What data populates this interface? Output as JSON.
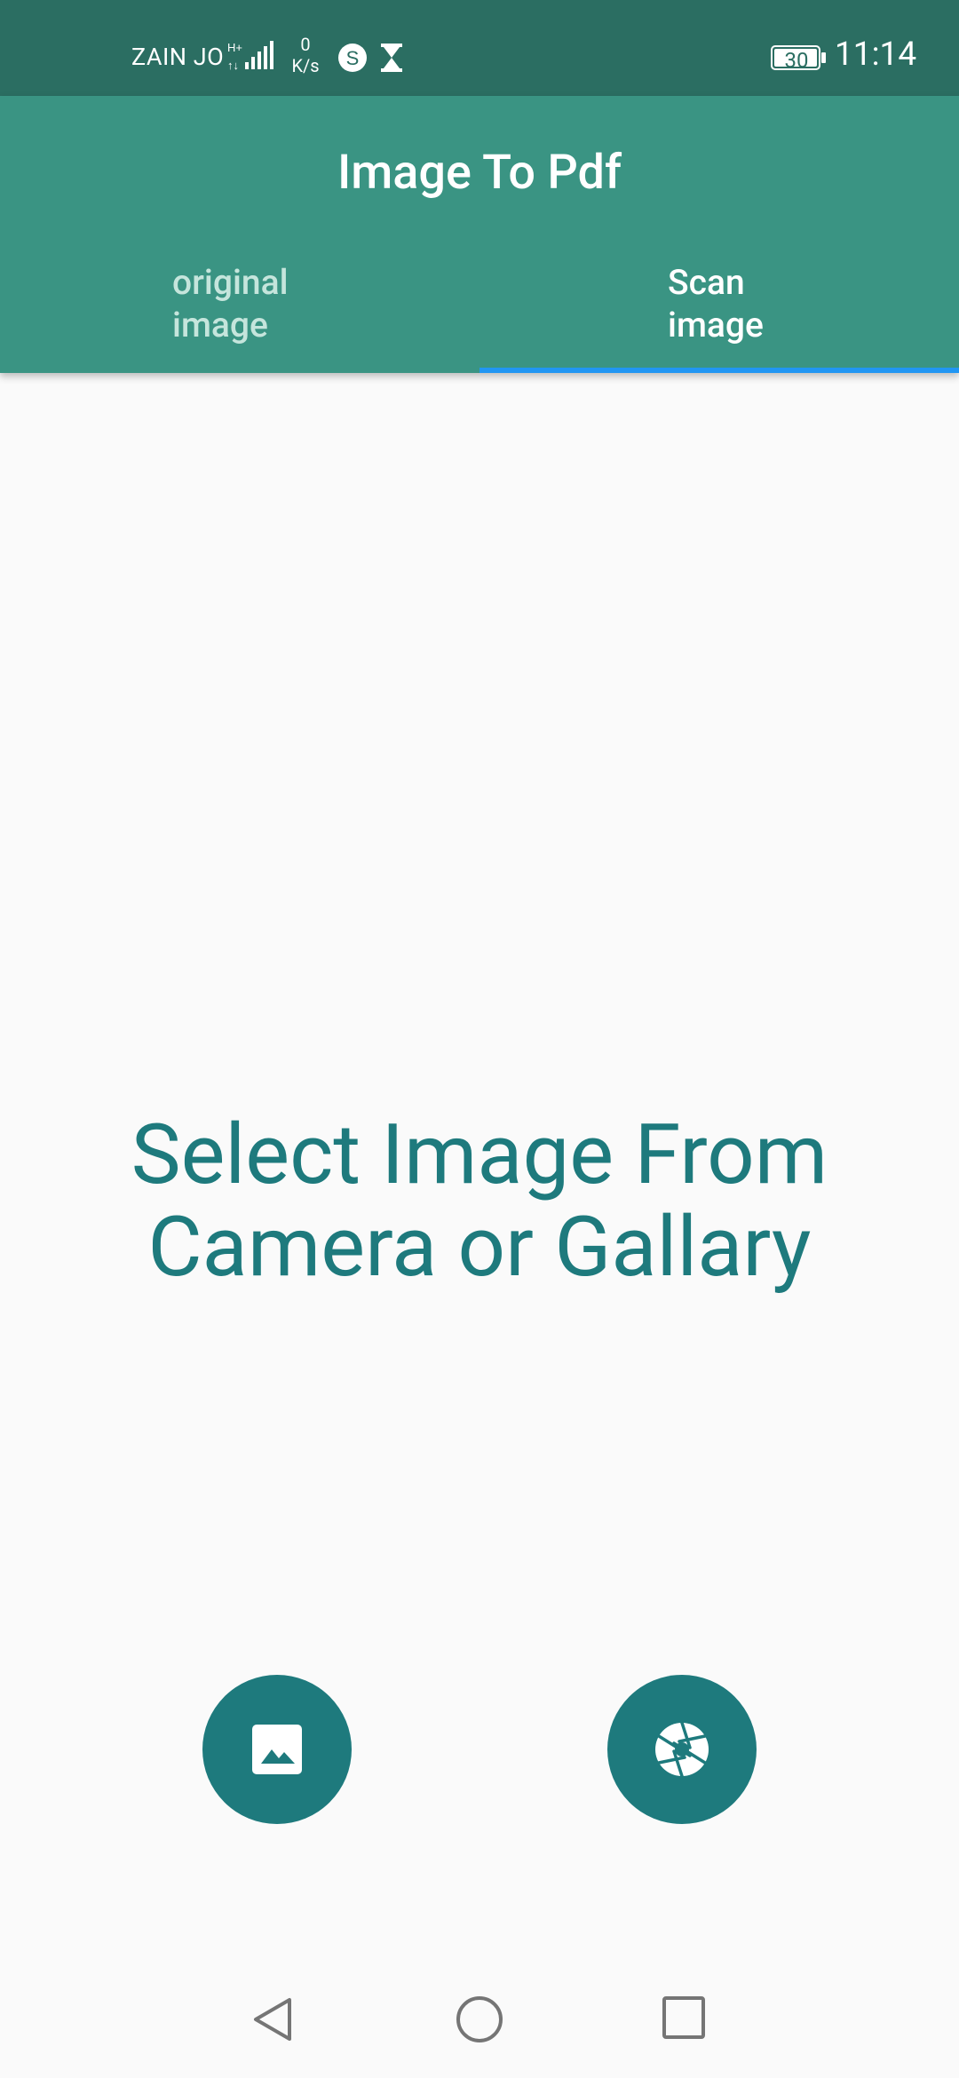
{
  "status_bar": {
    "carrier": "ZAIN JO",
    "net_speed_value": "0",
    "net_speed_unit": "K/s",
    "battery": "30",
    "time": "11:14"
  },
  "app_bar": {
    "title": "Image To Pdf",
    "tabs": [
      {
        "line1": "original",
        "line2": "image",
        "selected": false
      },
      {
        "line1": "Scan",
        "line2": "image",
        "selected": true
      }
    ]
  },
  "main": {
    "message_line1": "Select Image From",
    "message_line2": "Camera or Gallary"
  },
  "actions": {
    "gallery_icon": "image-icon",
    "camera_icon": "camera-shutter-icon"
  },
  "colors": {
    "status_bar": "#2b6e62",
    "app_bar": "#3a9483",
    "accent": "#1e7a7d",
    "tab_indicator": "#2196f3"
  }
}
